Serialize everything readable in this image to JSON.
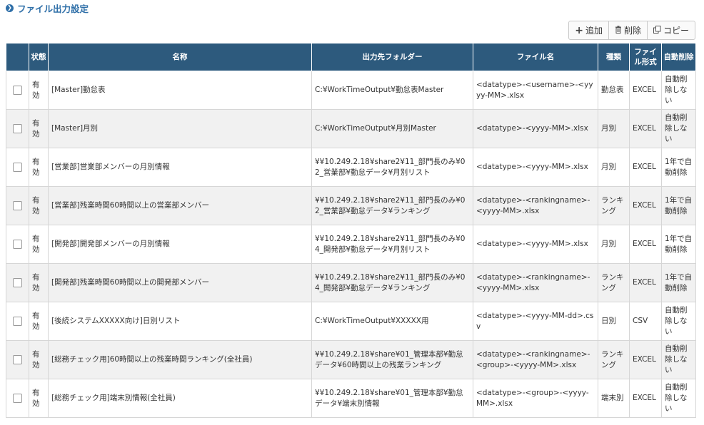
{
  "page": {
    "title": "ファイル出力設定"
  },
  "toolbar": {
    "add_label": "追加",
    "delete_label": "削除",
    "copy_label": "コピー"
  },
  "icons": {
    "add": "plus-icon",
    "delete": "trash-icon",
    "copy": "copy-icon",
    "title": "chevron-right-circle-icon"
  },
  "colors": {
    "header_bg": "#2d5a7d",
    "link": "#2f6fa8",
    "row_alt": "#f1f1f1"
  },
  "table": {
    "headers": {
      "status": "状態",
      "name": "名称",
      "folder": "出力先フォルダー",
      "filename": "ファイル名",
      "kind": "種類",
      "format": "ファイル形式",
      "autodelete": "自動削除"
    },
    "rows": [
      {
        "status": "有効",
        "name": "[Master]勤怠表",
        "folder": "C:¥WorkTimeOutput¥勤怠表Master",
        "filename": "<datatype>-<username>-<yyyy-MM>.xlsx",
        "kind": "勤怠表",
        "format": "EXCEL",
        "autodelete": "自動削除しない"
      },
      {
        "status": "有効",
        "name": "[Master]月別",
        "folder": "C:¥WorkTimeOutput¥月別Master",
        "filename": "<datatype>-<yyyy-MM>.xlsx",
        "kind": "月別",
        "format": "EXCEL",
        "autodelete": "自動削除しない"
      },
      {
        "status": "有効",
        "name": "[営業部]営業部メンバーの月別情報",
        "folder": "¥¥10.249.2.18¥share2¥11_部門長のみ¥02_営業部¥勤怠データ¥月別リスト",
        "filename": "<datatype>-<yyyy-MM>.xlsx",
        "kind": "月別",
        "format": "EXCEL",
        "autodelete": "1年で自動削除"
      },
      {
        "status": "有効",
        "name": "[営業部]残業時間60時間以上の営業部メンバー",
        "folder": "¥¥10.249.2.18¥share2¥11_部門長のみ¥02_営業部¥勤怠データ¥ランキング",
        "filename": "<datatype>-<rankingname>-<yyyy-MM>.xlsx",
        "kind": "ランキング",
        "format": "EXCEL",
        "autodelete": "1年で自動削除"
      },
      {
        "status": "有効",
        "name": "[開発部]開発部メンバーの月別情報",
        "folder": "¥¥10.249.2.18¥share2¥11_部門長のみ¥04_開発部¥勤怠データ¥月別リスト",
        "filename": "<datatype>-<yyyy-MM>.xlsx",
        "kind": "月別",
        "format": "EXCEL",
        "autodelete": "1年で自動削除"
      },
      {
        "status": "有効",
        "name": "[開発部]残業時間60時間以上の開発部メンバー",
        "folder": "¥¥10.249.2.18¥share2¥11_部門長のみ¥04_開発部¥勤怠データ¥ランキング",
        "filename": "<datatype>-<rankingname>-<yyyy-MM>.xlsx",
        "kind": "ランキング",
        "format": "EXCEL",
        "autodelete": "1年で自動削除"
      },
      {
        "status": "有効",
        "name": "[後続システムXXXXX向け]日別リスト",
        "folder": "C:¥WorkTimeOutput¥XXXXX用",
        "filename": "<datatype>-<yyyy-MM-dd>.csv",
        "kind": "日別",
        "format": "CSV",
        "autodelete": "自動削除しない"
      },
      {
        "status": "有効",
        "name": "[総務チェック用]60時間以上の残業時間ランキング(全社員)",
        "folder": "¥¥10.249.2.18¥share¥01_管理本部¥勤怠データ¥60時間以上の残業ランキング",
        "filename": "<datatype>-<rankingname>-<group>-<yyyy-MM>.xlsx",
        "kind": "ランキング",
        "format": "EXCEL",
        "autodelete": "自動削除しない"
      },
      {
        "status": "有効",
        "name": "[総務チェック用]端末別情報(全社員)",
        "folder": "¥¥10.249.2.18¥share¥01_管理本部¥勤怠データ¥端末別情報",
        "filename": "<datatype>-<group>-<yyyy-MM>.xlsx",
        "kind": "端末別",
        "format": "EXCEL",
        "autodelete": "自動削除しない"
      }
    ]
  }
}
